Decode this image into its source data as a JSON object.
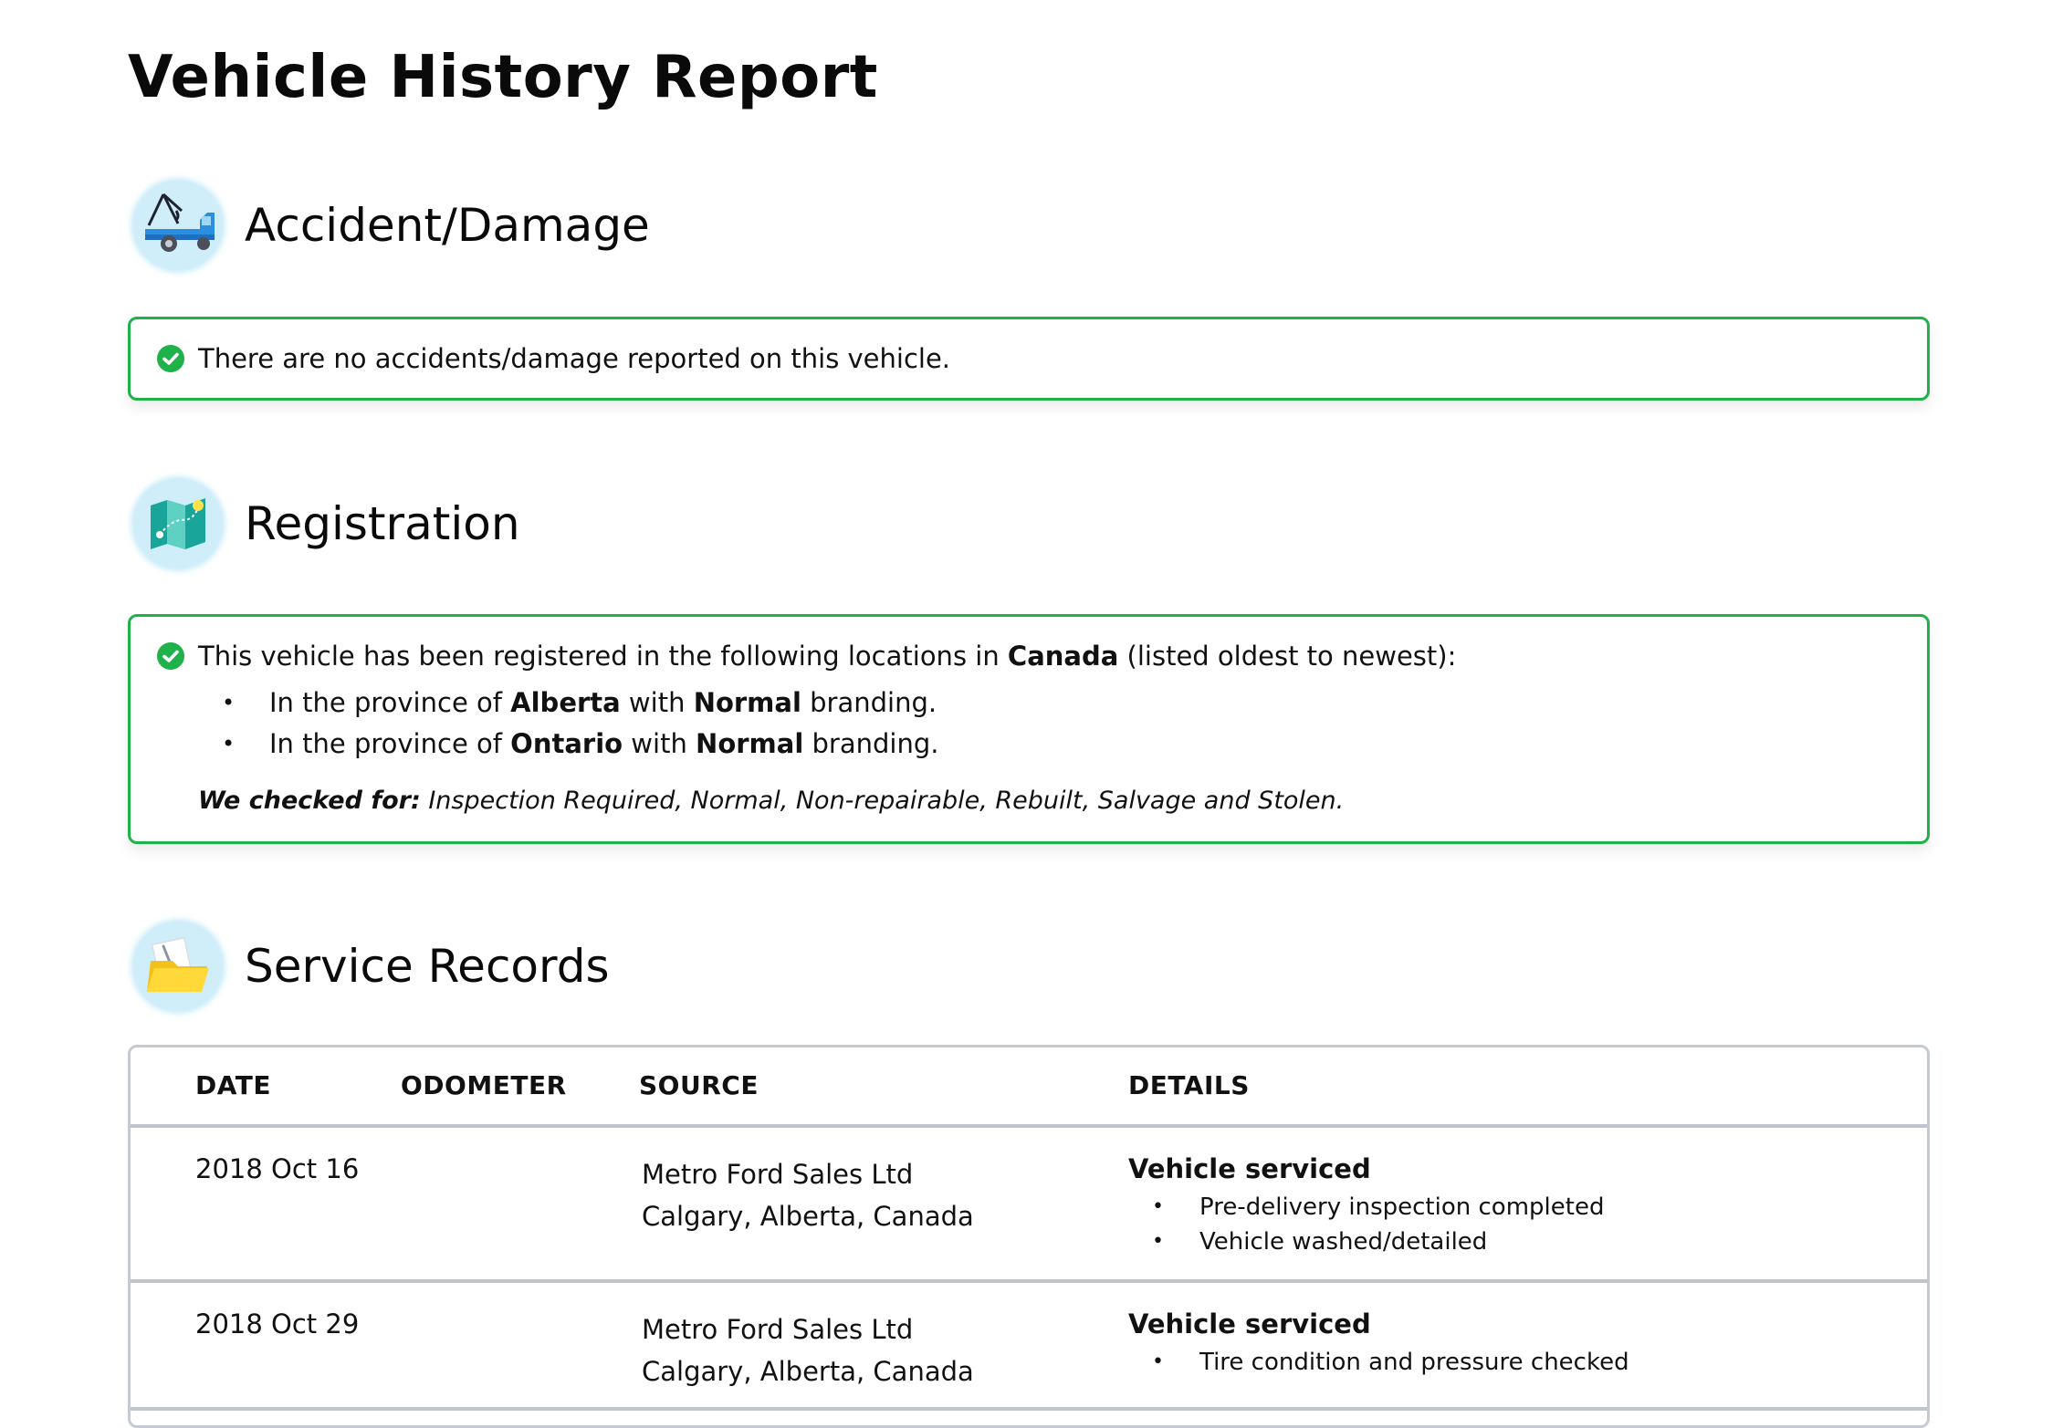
{
  "report": {
    "title": "Vehicle History Report"
  },
  "accident": {
    "title": "Accident/Damage",
    "icon": "tow-truck-icon",
    "message": "There are no accidents/damage reported on this vehicle.",
    "status_color": "#1fb24a"
  },
  "registration": {
    "title": "Registration",
    "icon": "map-icon",
    "intro_prefix": "This vehicle has been registered in the following locations in ",
    "country": "Canada",
    "intro_suffix": " (listed oldest to newest):",
    "locations": [
      {
        "prefix": "In the province of ",
        "province": "Alberta",
        "middle": " with ",
        "branding": "Normal",
        "suffix": " branding."
      },
      {
        "prefix": "In the province of ",
        "province": "Ontario",
        "middle": " with ",
        "branding": "Normal",
        "suffix": " branding."
      }
    ],
    "checked_label": "We checked for:",
    "checked_items": " Inspection Required, Normal, Non-repairable, Rebuilt, Salvage and Stolen."
  },
  "service": {
    "title": "Service Records",
    "icon": "folder-icon",
    "columns": {
      "date": "DATE",
      "odometer": "ODOMETER",
      "source": "SOURCE",
      "details": "DETAILS"
    },
    "rows": [
      {
        "date": "2018 Oct 16",
        "odometer": "",
        "source_name": "Metro Ford Sales Ltd",
        "source_location": "Calgary, Alberta, Canada",
        "details_title": "Vehicle serviced",
        "details_items": [
          "Pre-delivery inspection completed",
          "Vehicle washed/detailed"
        ]
      },
      {
        "date": "2018 Oct 29",
        "odometer": "",
        "source_name": "Metro Ford Sales Ltd",
        "source_location": "Calgary, Alberta, Canada",
        "details_title": "Vehicle serviced",
        "details_items": [
          "Tire condition and pressure checked"
        ]
      }
    ]
  }
}
